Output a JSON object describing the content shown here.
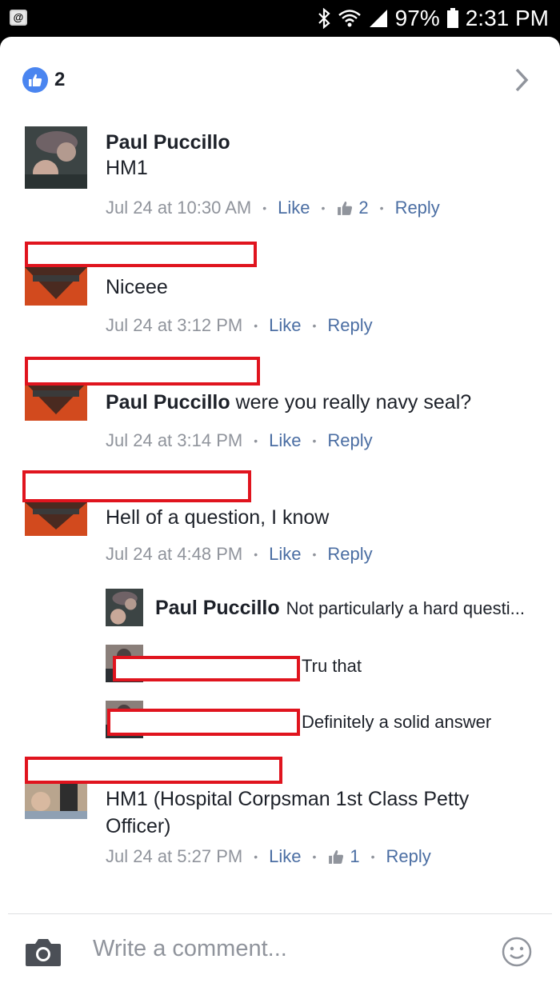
{
  "status_bar": {
    "battery": "97%",
    "time": "2:31 PM",
    "icons": [
      "notification-icon",
      "bluetooth-icon",
      "wifi-icon",
      "signal-icon",
      "battery-icon"
    ]
  },
  "header": {
    "like_count": "2",
    "icons": [
      "like-bubble-icon",
      "chevron-right-icon"
    ]
  },
  "comments": [
    {
      "author": "Paul Puccillo",
      "text": "HM1",
      "time": "Jul 24 at 10:30 AM",
      "like_label": "Like",
      "reaction_count": "2",
      "reply_label": "Reply"
    },
    {
      "author": "",
      "text": "Niceee",
      "time": "Jul 24 at 3:12 PM",
      "like_label": "Like",
      "reply_label": "Reply"
    },
    {
      "author": "",
      "mention": "Paul Puccillo",
      "text": " were you really navy seal?",
      "time": "Jul 24 at 3:14 PM",
      "like_label": "Like",
      "reply_label": "Reply"
    },
    {
      "author": "",
      "text": "Hell of a question, I know",
      "time": "Jul 24 at 4:48 PM",
      "like_label": "Like",
      "reply_label": "Reply",
      "replies": [
        {
          "author": "Paul Puccillo",
          "text": "Not particularly a hard questi..."
        },
        {
          "author": "",
          "text": "Tru that"
        },
        {
          "author": "",
          "text": "Definitely a solid answer"
        }
      ]
    },
    {
      "author": "",
      "text": "HM1 (Hospital Corpsman 1st Class Petty Officer)",
      "time": "Jul 24 at 5:27 PM",
      "like_label": "Like",
      "reaction_count": "1",
      "reply_label": "Reply"
    }
  ],
  "composer": {
    "placeholder": "Write a comment...",
    "icons": [
      "camera-icon",
      "smiley-icon"
    ]
  },
  "colors": {
    "link": "#4b6ea3",
    "like_blue": "#4a85f0",
    "redaction": "#e0141e",
    "meta_gray": "#90949c"
  }
}
